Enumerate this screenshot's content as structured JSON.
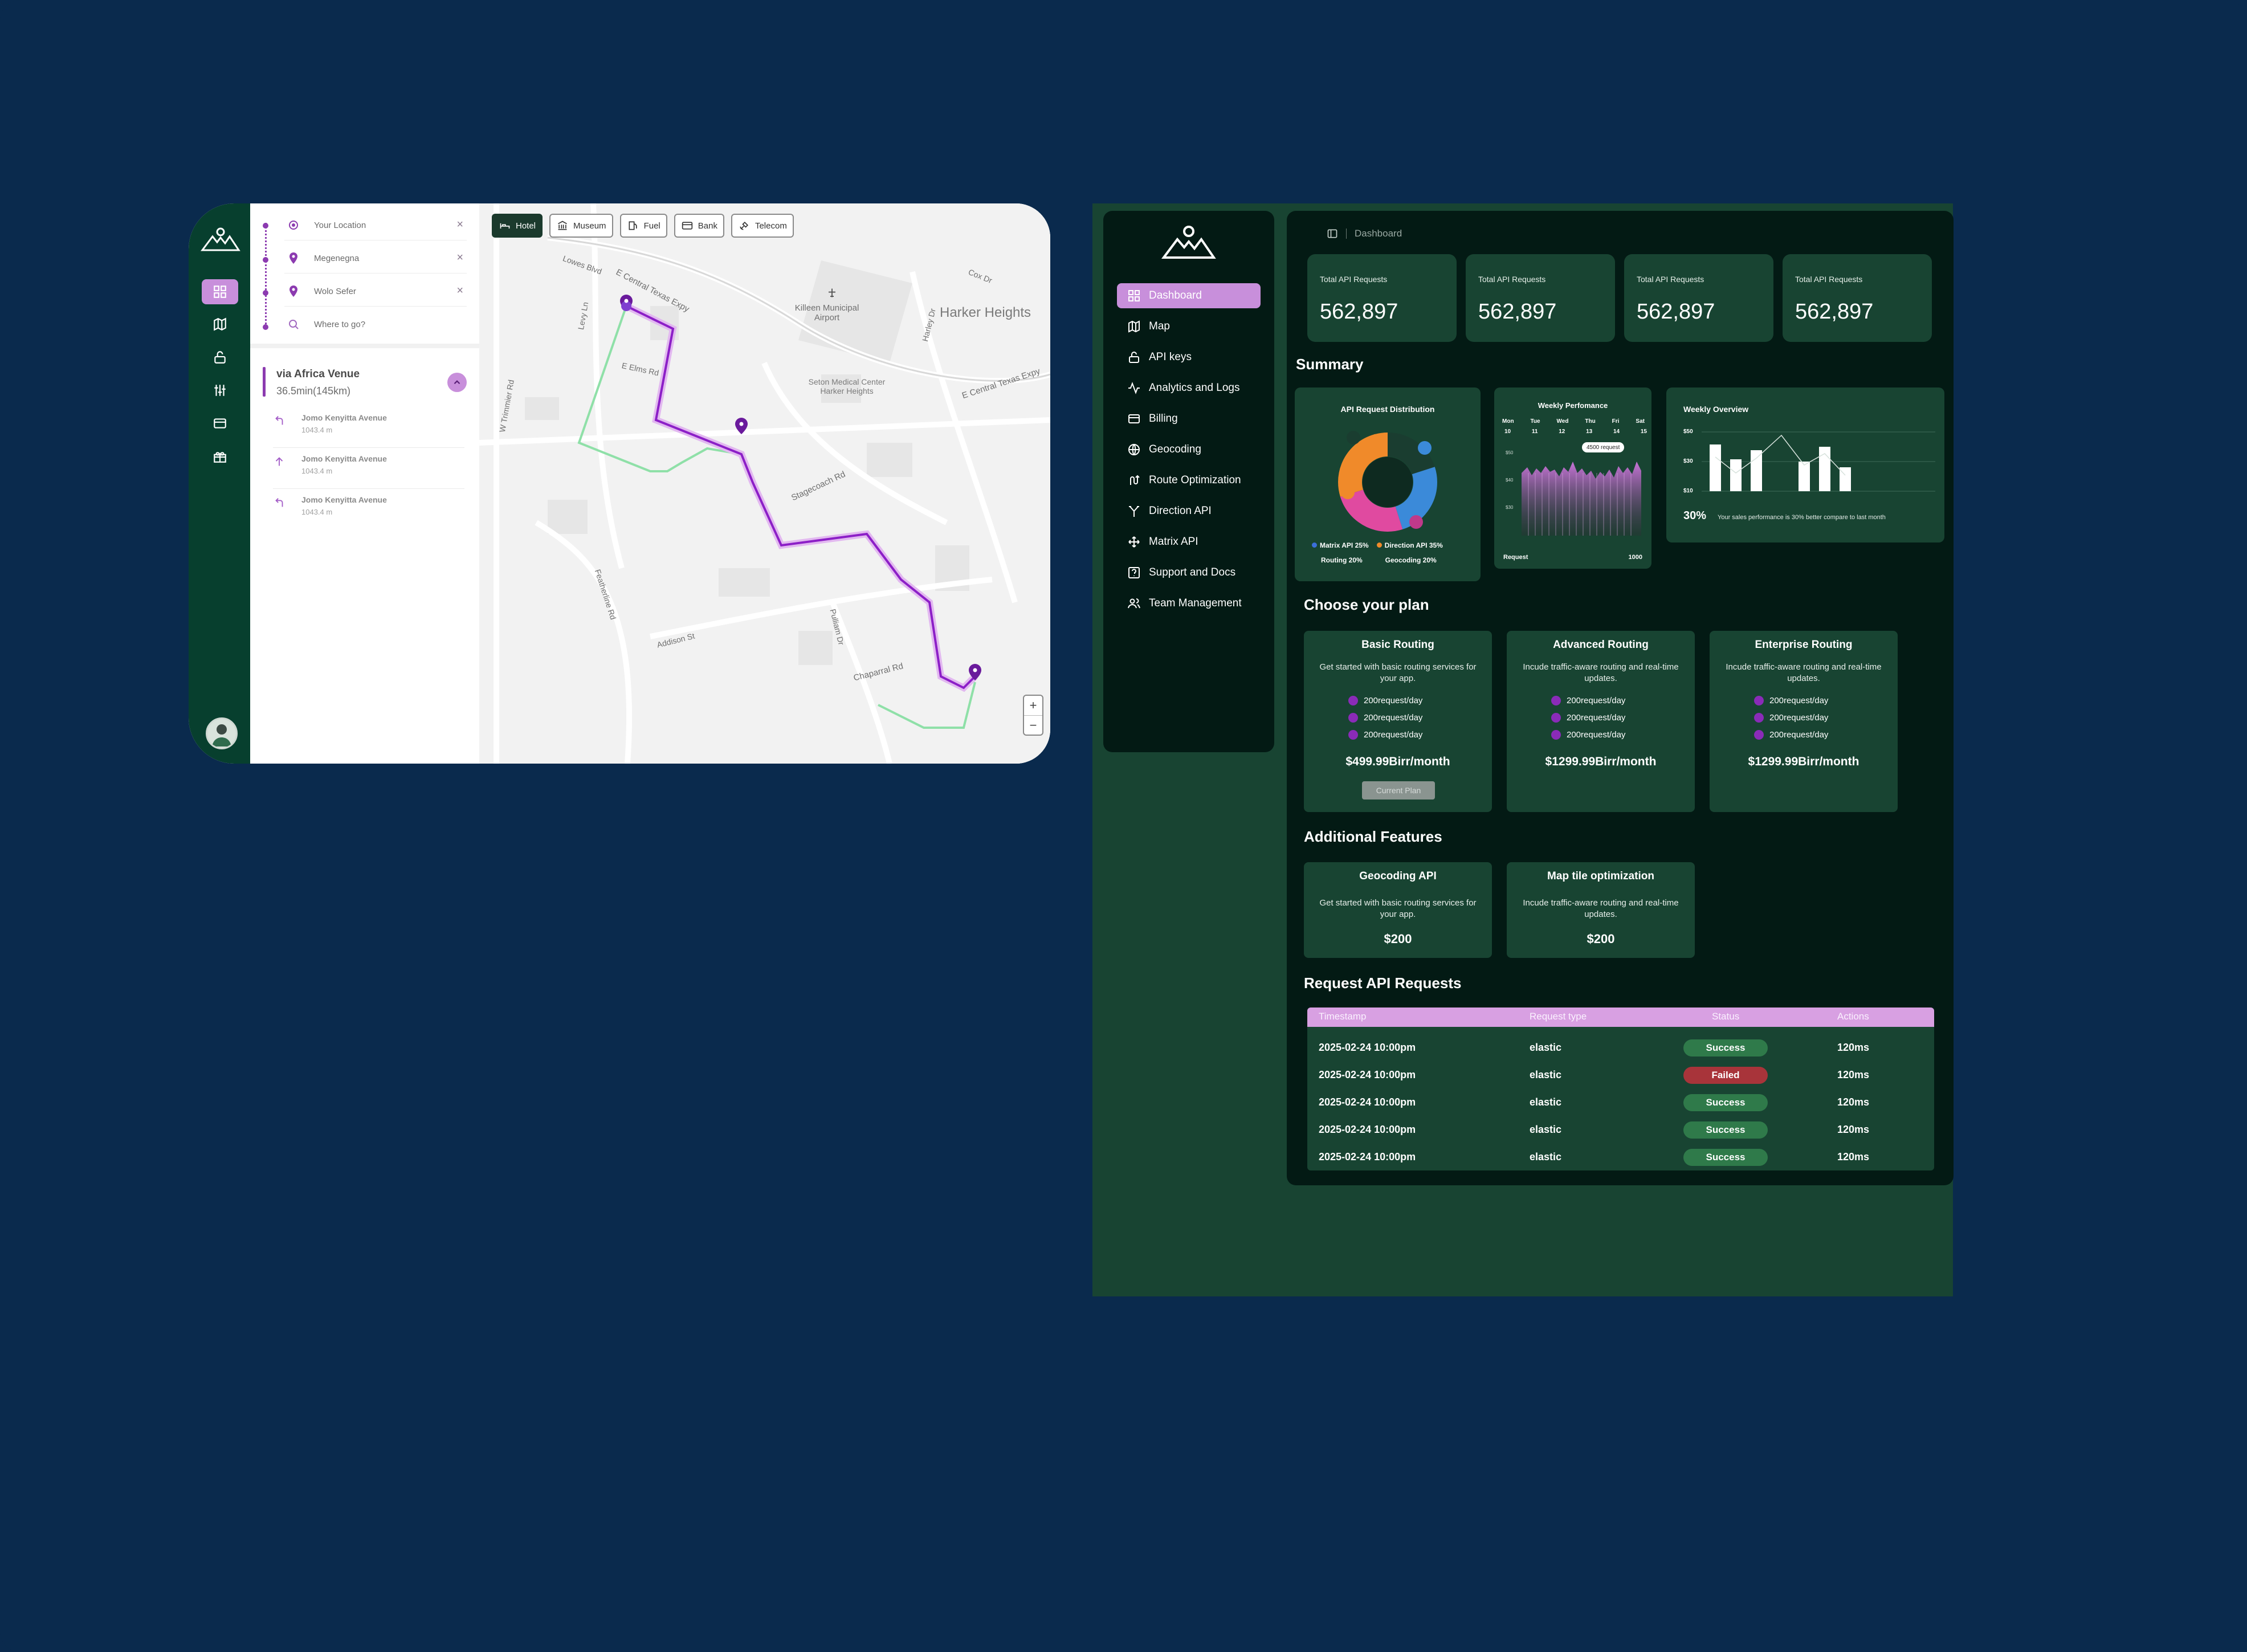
{
  "map_app": {
    "stops": [
      {
        "label": "Your Location"
      },
      {
        "label": "Megenegna"
      },
      {
        "label": "Wolo Sefer"
      },
      {
        "label": "Where to go?"
      }
    ],
    "route": {
      "title": "via Africa Venue",
      "subtitle": "36.5min(145km)"
    },
    "steps": [
      {
        "street": "Jomo Kenyitta Avenue",
        "distance": "1043.4 m",
        "icon": "turn-left-icon"
      },
      {
        "street": "Jomo Kenyitta Avenue",
        "distance": "1043.4 m",
        "icon": "straight-arrow-icon"
      },
      {
        "street": "Jomo Kenyitta Avenue",
        "distance": "1043.4 m",
        "icon": "turn-left-icon"
      }
    ],
    "chips": [
      "Hotel",
      "Museum",
      "Fuel",
      "Bank",
      "Telecom"
    ],
    "map_labels": {
      "airport": "Killeen Municipal Airport",
      "city": "Harker Heights",
      "medical": "Seton Medical Center Harker Heights",
      "road1": "E Central Texas Expy",
      "road2": "E Central Texas Expy",
      "road3": "Stagecoach Rd",
      "road4": "Chaparral Rd",
      "road5": "Addison St",
      "road6": "Featherline Rd",
      "road7": "W Trimmier Rd",
      "road8": "E Elms Rd",
      "road9": "Lowes Blvd",
      "road10": "Cox Dr",
      "road11": "Pulliam Dr",
      "road12": "Levy Ln",
      "road13": "Harley Dr"
    },
    "zoom_in": "+",
    "zoom_out": "−"
  },
  "dashboard": {
    "nav": [
      {
        "label": "Dashboard",
        "icon": "grid-icon",
        "active": true
      },
      {
        "label": "Map",
        "icon": "map-icon"
      },
      {
        "label": "API keys",
        "icon": "lock-icon"
      },
      {
        "label": "Analytics and Logs",
        "icon": "activity-icon"
      },
      {
        "label": "Billing",
        "icon": "billing-icon"
      },
      {
        "label": "Geocoding",
        "icon": "globe-icon"
      },
      {
        "label": "Route Optimization",
        "icon": "route-icon"
      },
      {
        "label": "Direction API",
        "icon": "direction-icon"
      },
      {
        "label": "Matrix API",
        "icon": "matrix-icon"
      },
      {
        "label": "Support and Docs",
        "icon": "support-icon"
      },
      {
        "label": "Team Management",
        "icon": "team-icon"
      }
    ],
    "breadcrumb": "Dashboard",
    "stats": [
      {
        "label": "Total API Requests",
        "value": "562,897"
      },
      {
        "label": "Total API Requests",
        "value": "562,897"
      },
      {
        "label": "Total API Requests",
        "value": "562,897"
      },
      {
        "label": "Total API Requests",
        "value": "562,897"
      }
    ],
    "summary_title": "Summary",
    "distribution": {
      "title": "API Request Distribution",
      "legend": [
        {
          "label": "Matrix API 25%",
          "color": "#3b6fd9"
        },
        {
          "label": "Direction API 35%",
          "color": "#f08a2a"
        },
        {
          "label": "Routing 20%",
          "color": "#1a3d30"
        },
        {
          "label": "Geocoding 20%",
          "color": "#e04aa0"
        }
      ]
    },
    "weekly_perf": {
      "title": "Weekly Perfomance",
      "days": [
        "Mon",
        "Tue",
        "Wed",
        "Thu",
        "Fri",
        "Sat"
      ],
      "dates": [
        "10",
        "11",
        "12",
        "13",
        "14",
        "15"
      ],
      "yticks": [
        "$50",
        "$40",
        "$30"
      ],
      "tooltip": "4500 request",
      "xlabel": "Request",
      "xmax": "1000"
    },
    "weekly_overview": {
      "title": "Weekly Overview",
      "yticks": [
        "$50",
        "$30",
        "$10"
      ],
      "percent": "30%",
      "note": "Your sales performance is 30% better compare to last month"
    },
    "plans_title": "Choose your plan",
    "plans": [
      {
        "title": "Basic Routing",
        "desc": "Get started with basic routing services for your app.",
        "features": [
          "200request/day",
          "200request/day",
          "200request/day"
        ],
        "price": "$499.99Birr/month",
        "button": "Current Plan"
      },
      {
        "title": "Advanced Routing",
        "desc": "Incude traffic-aware routing and real-time updates.",
        "features": [
          "200request/day",
          "200request/day",
          "200request/day"
        ],
        "price": "$1299.99Birr/month"
      },
      {
        "title": "Enterprise Routing",
        "desc": "Incude traffic-aware routing and real-time updates.",
        "features": [
          "200request/day",
          "200request/day",
          "200request/day"
        ],
        "price": "$1299.99Birr/month"
      }
    ],
    "features_title": "Additional Features",
    "features": [
      {
        "title": "Geocoding API",
        "desc": "Get started with basic routing services for your app.",
        "price": "$200"
      },
      {
        "title": "Map tile optimization",
        "desc": "Incude traffic-aware routing and real-time updates.",
        "price": "$200"
      }
    ],
    "requests_title": "Request API Requests",
    "table": {
      "headers": [
        "Timestamp",
        "Request type",
        "Status",
        "Actions"
      ],
      "rows": [
        {
          "timestamp": "2025-02-24 10:00pm",
          "type": "elastic",
          "status": "Success",
          "action": "120ms"
        },
        {
          "timestamp": "2025-02-24 10:00pm",
          "type": "elastic",
          "status": "Failed",
          "action": "120ms"
        },
        {
          "timestamp": "2025-02-24 10:00pm",
          "type": "elastic",
          "status": "Success",
          "action": "120ms"
        },
        {
          "timestamp": "2025-02-24 10:00pm",
          "type": "elastic",
          "status": "Success",
          "action": "120ms"
        },
        {
          "timestamp": "2025-02-24 10:00pm",
          "type": "elastic",
          "status": "Success",
          "action": "120ms"
        }
      ]
    },
    "colors": {
      "success": "#2f7a4a",
      "failed": "#a8343a",
      "accent": "#c88fdb"
    }
  }
}
